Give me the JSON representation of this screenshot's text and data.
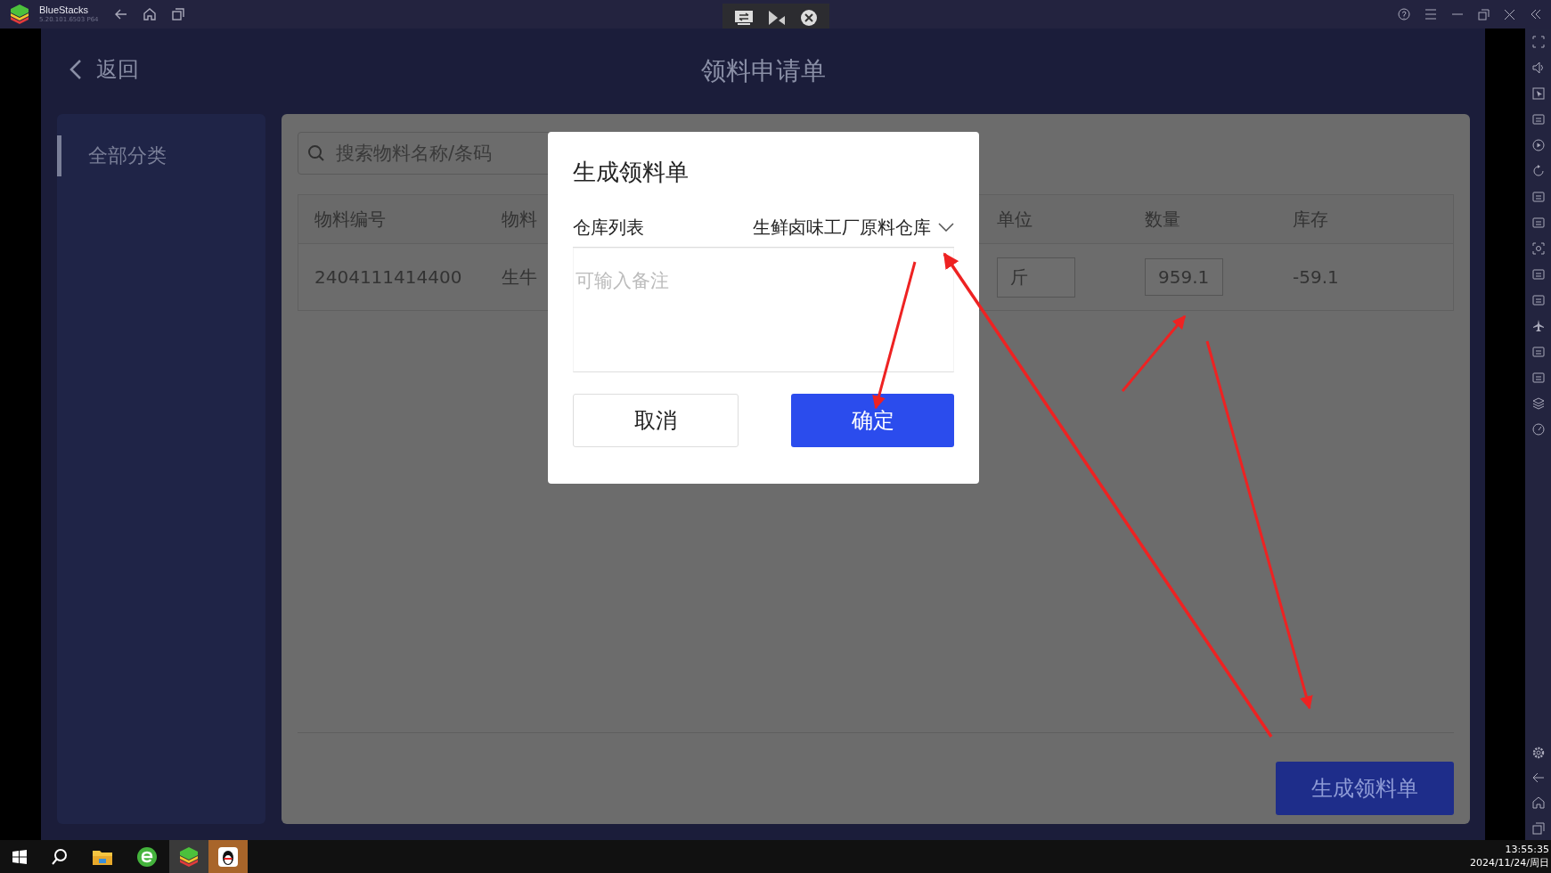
{
  "emulator": {
    "name": "BlueStacks",
    "version": "5.20.101.6503 P64"
  },
  "app": {
    "back_label": "返回",
    "title": "领料申请单",
    "categories": [
      {
        "label": "全部分类",
        "selected": true
      }
    ],
    "search": {
      "placeholder": "搜索物料名称/条码"
    },
    "table": {
      "columns": [
        "物料编号",
        "物料",
        "单位",
        "数量",
        "库存"
      ],
      "rows": [
        {
          "code": "2404111414400",
          "name": "生牛",
          "unit": "斤",
          "quantity": "959.1",
          "stock": "-59.1"
        }
      ]
    },
    "generate_button": "生成领料单"
  },
  "dialog": {
    "title": "生成领料单",
    "warehouse_label": "仓库列表",
    "warehouse_value": "生鲜卤味工厂原料仓库",
    "note": {
      "placeholder": "可输入备注"
    },
    "cancel": "取消",
    "confirm": "确定"
  },
  "clock": {
    "time": "13:55:35",
    "date": "2024/11/24/周日"
  }
}
